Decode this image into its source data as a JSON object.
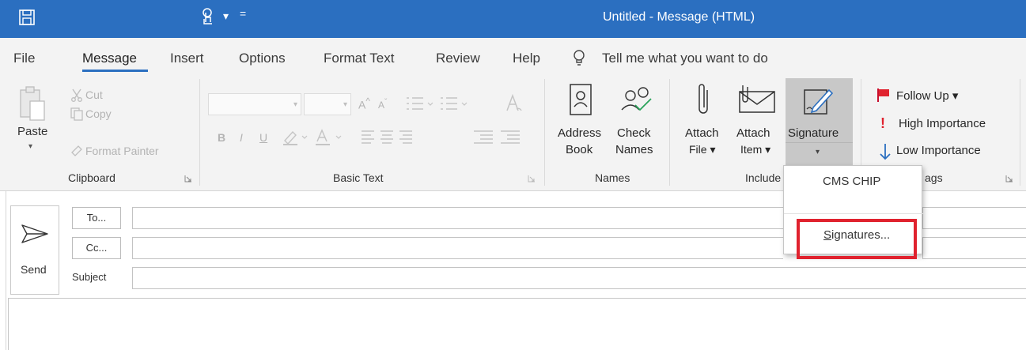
{
  "window": {
    "title": "Untitled  -  Message (HTML)",
    "qa_more": "▾",
    "qa_customize": "="
  },
  "tabs": [
    {
      "label": "File"
    },
    {
      "label": "Message"
    },
    {
      "label": "Insert"
    },
    {
      "label": "Options"
    },
    {
      "label": "Format Text"
    },
    {
      "label": "Review"
    },
    {
      "label": "Help"
    }
  ],
  "tellme": {
    "label": "Tell me what you want to do"
  },
  "clipboard": {
    "paste": "Paste",
    "paste_arrow": "▾",
    "cut": "Cut",
    "copy": "Copy",
    "format_painter": "Format Painter",
    "group_label": "Clipboard"
  },
  "basic_text": {
    "group_label": "Basic Text",
    "bold": "B",
    "italic": "I",
    "underline": "U"
  },
  "names": {
    "address_book_1": "Address",
    "address_book_2": "Book",
    "check_names_1": "Check",
    "check_names_2": "Names",
    "group_label": "Names"
  },
  "include": {
    "attach_file_1": "Attach",
    "attach_file_2": "File ▾",
    "attach_item_1": "Attach",
    "attach_item_2": "Item ▾",
    "signature": "Signature",
    "signature_arrow": "▾",
    "group_label": "Include"
  },
  "tags": {
    "follow_up": "Follow Up ▾",
    "high_importance": "High Importance",
    "low_importance": "Low Importance",
    "group_label": "ags"
  },
  "signature_menu": {
    "items": [
      {
        "label": "CMS CHIP"
      },
      {
        "label": "Signatures..."
      }
    ]
  },
  "compose": {
    "send": "Send",
    "to": "To...",
    "cc": "Cc...",
    "subject": "Subject"
  },
  "colors": {
    "titlebar": "#2b6fc0",
    "ribbon": "#f3f3f3",
    "highlight": "#e0222e",
    "flag_red": "#e0222e",
    "arrow_blue": "#2b6fc0"
  }
}
